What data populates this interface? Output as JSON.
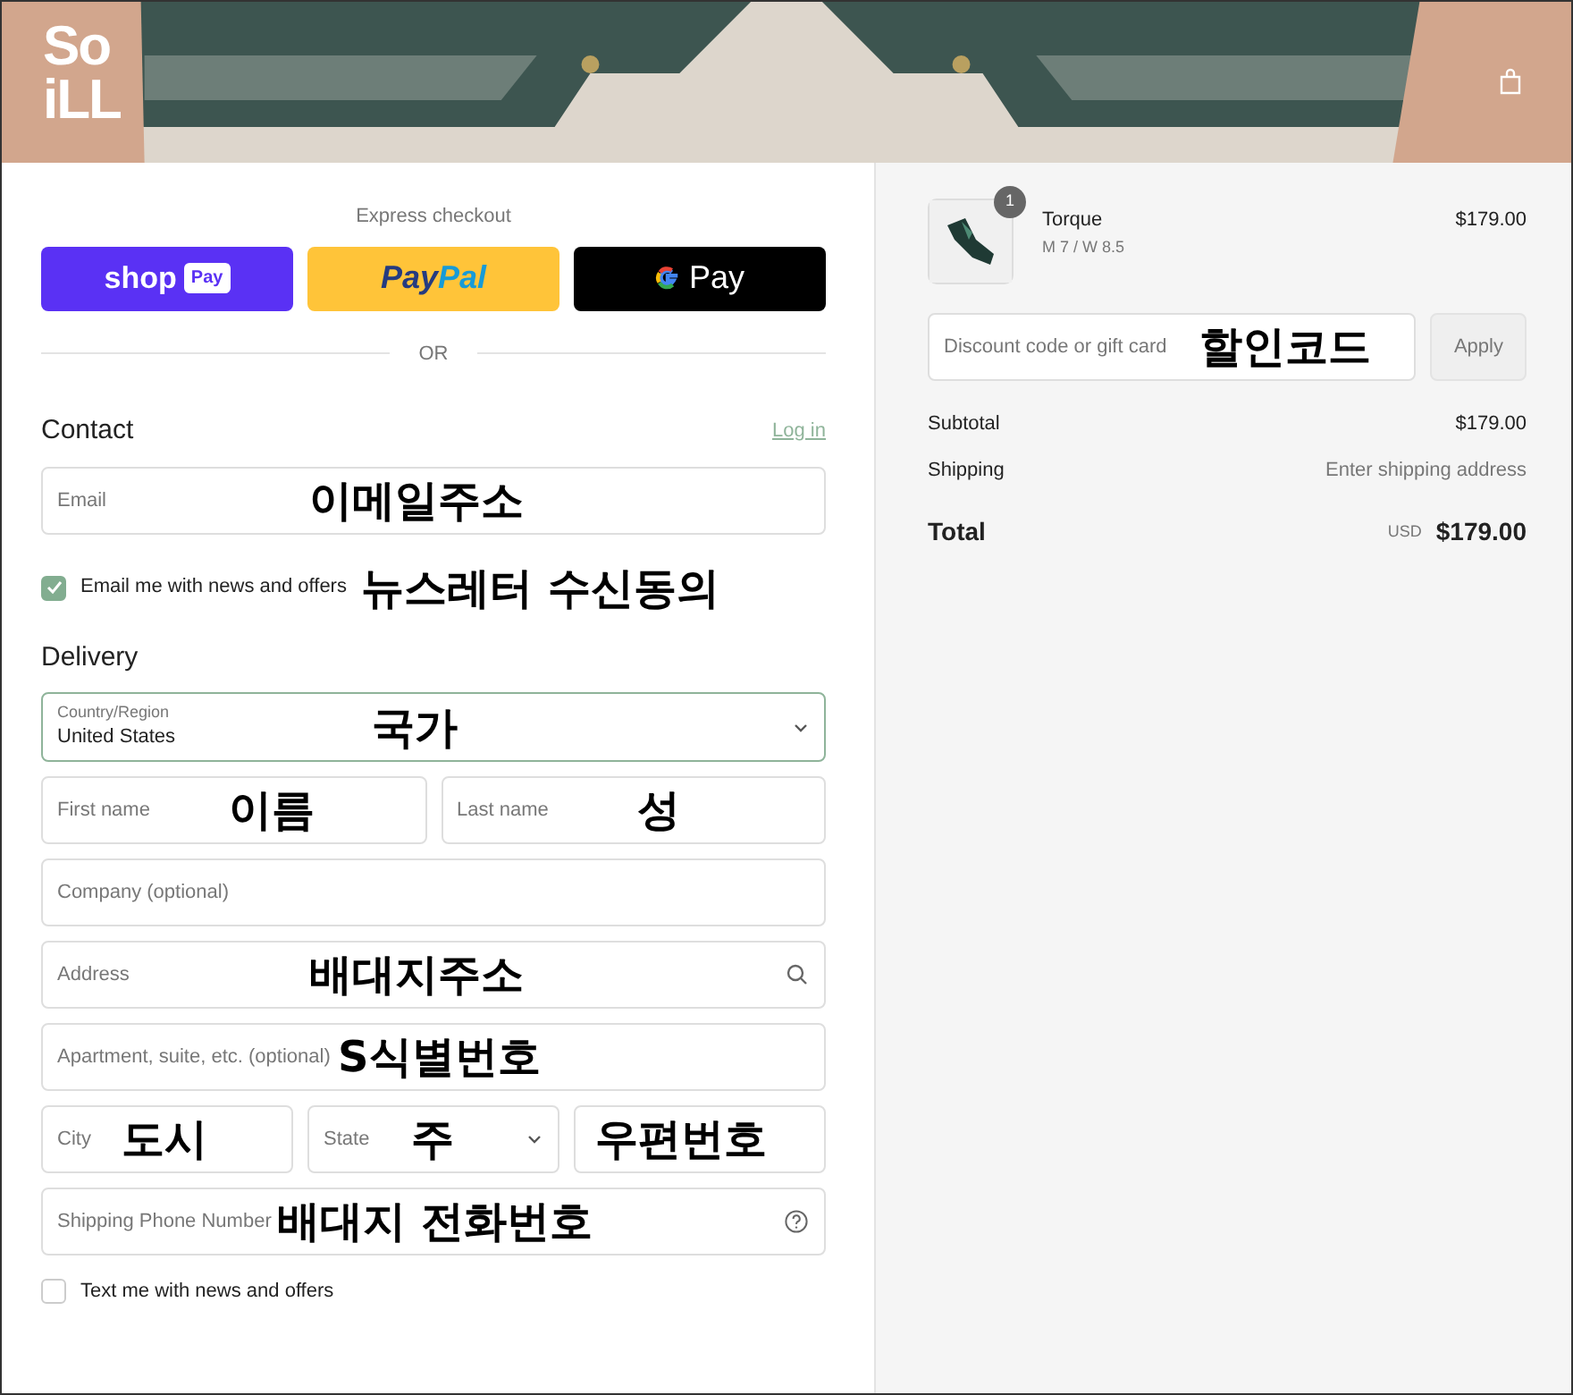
{
  "header": {
    "logo": [
      "So",
      "iLL"
    ],
    "kind": "picture"
  },
  "express": {
    "title": "Express checkout",
    "buttons": [
      {
        "kind": "shop",
        "parts": [
          "shop",
          "Pay"
        ]
      },
      {
        "kind": "paypal",
        "parts": [
          "Pay",
          "Pal"
        ]
      },
      {
        "kind": "gpay",
        "parts": [
          "Pay"
        ]
      }
    ],
    "divider": "OR"
  },
  "contact": {
    "heading": "Contact",
    "link": "Log in",
    "email": {
      "placeholder": "Email",
      "note": "이메일주소"
    },
    "newsletter": {
      "label": "Email me with news and offers",
      "checked": true,
      "note": "뉴스레터 수신동의"
    }
  },
  "delivery": {
    "heading": "Delivery",
    "groups": [
      {
        "fields": [
          {
            "kind": "select",
            "label": "Country/Region",
            "value": "United States",
            "note": "국가",
            "focused": true
          }
        ]
      },
      {
        "fields": [
          {
            "kind": "text",
            "placeholder": "First name",
            "note": "이름"
          },
          {
            "kind": "text",
            "placeholder": "Last name",
            "note": "성"
          }
        ]
      },
      {
        "fields": [
          {
            "kind": "text",
            "placeholder": "Company (optional)"
          }
        ]
      },
      {
        "fields": [
          {
            "kind": "search",
            "placeholder": "Address",
            "note": "배대지주소"
          }
        ]
      },
      {
        "fields": [
          {
            "kind": "text",
            "placeholder": "Apartment, suite, etc. (optional)",
            "note": "S식별번호"
          }
        ]
      },
      {
        "fields": [
          {
            "kind": "text",
            "placeholder": "City",
            "note": "도시"
          },
          {
            "kind": "select",
            "placeholder": "State",
            "note": "주"
          },
          {
            "kind": "text",
            "note": "우편번호"
          }
        ]
      },
      {
        "fields": [
          {
            "kind": "help",
            "placeholder": "Shipping Phone Number",
            "note": "배대지 전화번호"
          }
        ]
      }
    ],
    "sms": {
      "label": "Text me with news and offers",
      "checked": false
    }
  },
  "summary": {
    "item": {
      "name": "Torque",
      "variant": "M 7 / W 8.5",
      "price": "$179.00",
      "quantity": "1"
    },
    "discount": {
      "placeholder": "Discount code or gift card",
      "note": "할인코드",
      "button": "Apply"
    },
    "lines": [
      {
        "label": "Subtotal",
        "value": "$179.00",
        "muted": false
      },
      {
        "label": "Shipping",
        "value": "Enter shipping address",
        "muted": true
      }
    ],
    "total": {
      "label": "Total",
      "currency": "USD",
      "value": "$179.00"
    }
  }
}
